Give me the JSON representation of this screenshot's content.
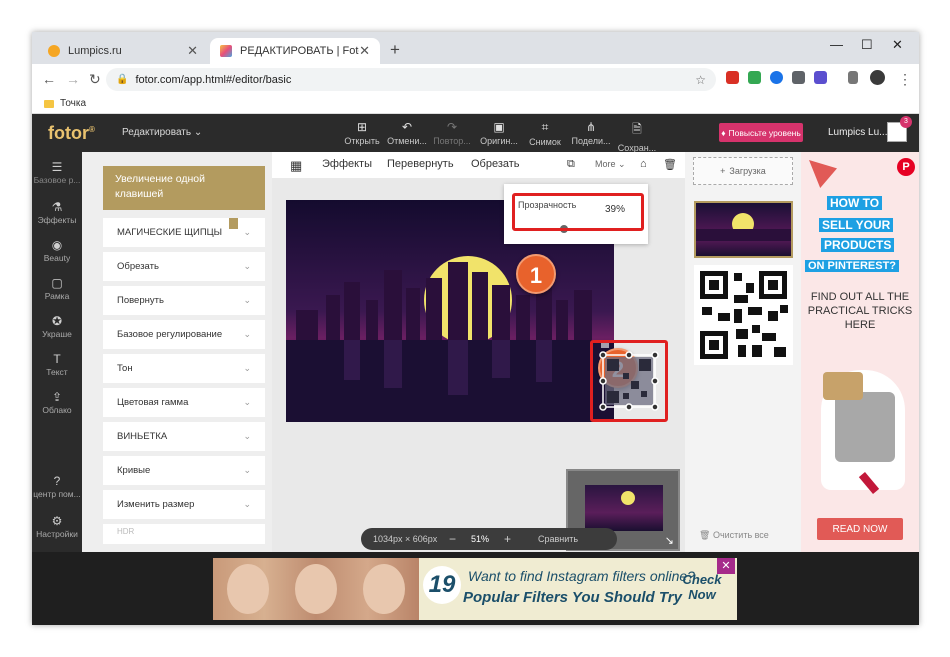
{
  "browser": {
    "tabs": [
      {
        "title": "Lumpics.ru",
        "favicon_color": "#f5a623",
        "active": false
      },
      {
        "title": "РЕДАКТИРОВАТЬ | Fotor",
        "favicon_color": "#e84f7a",
        "active": true
      }
    ],
    "url": "fotor.com/app.html#/editor/basic",
    "bookmark": "Точка",
    "window_controls": [
      "—",
      "☐",
      "✕"
    ]
  },
  "header": {
    "logo": "fotor",
    "logo_mark": "®",
    "edit_menu": "Редактировать",
    "tools": [
      {
        "label": "Открыть",
        "icon": "open-image-icon",
        "enabled": true
      },
      {
        "label": "Отмени...",
        "icon": "undo-icon",
        "enabled": true
      },
      {
        "label": "Повтор...",
        "icon": "redo-icon",
        "enabled": false
      },
      {
        "label": "Оригин...",
        "icon": "original-icon",
        "enabled": true
      },
      {
        "label": "Снимок",
        "icon": "snapshot-icon",
        "enabled": true
      },
      {
        "label": "Подели...",
        "icon": "share-icon",
        "enabled": true
      },
      {
        "label": "Сохран...",
        "icon": "save-icon",
        "enabled": true
      }
    ],
    "upgrade": "Повысьте уровень",
    "user": "Lumpics Lu...",
    "notifications": "3"
  },
  "rail": [
    {
      "label": "Базовое р...",
      "icon": "sliders-icon"
    },
    {
      "label": "Эффекты",
      "icon": "flask-icon"
    },
    {
      "label": "Beauty",
      "icon": "eye-icon"
    },
    {
      "label": "Рамка",
      "icon": "frame-icon"
    },
    {
      "label": "Украше",
      "icon": "star-icon"
    },
    {
      "label": "Текст",
      "icon": "text-icon"
    },
    {
      "label": "Облако",
      "icon": "cloud-upload-icon"
    },
    {
      "label": "центр пом...",
      "icon": "help-icon"
    },
    {
      "label": "Настройки",
      "icon": "settings-icon"
    }
  ],
  "panel": {
    "highlight": "Увеличение одной клавишей",
    "sections": [
      "МАГИЧЕСКИЕ ЩИПЦЫ",
      "Обрезать",
      "Повернуть",
      "Базовое регулирование",
      "Тон",
      "Цветовая гамма",
      "ВИНЬЕТКА",
      "Кривые",
      "Изменить размер",
      "HDR"
    ]
  },
  "canvas_toolbar": {
    "effects": "Эффекты",
    "flip": "Перевернуть",
    "crop": "Обрезать",
    "more": "More"
  },
  "opacity": {
    "label": "Прозрачность",
    "value": "39%",
    "fraction": 0.39
  },
  "callouts": [
    "1",
    "2"
  ],
  "zoom": {
    "size": "1034px × 606px",
    "percent": "51%",
    "minus": "−",
    "plus": "+",
    "compare": "Сравнить"
  },
  "right_panel": {
    "upload": "Загрузка",
    "clear": "Очистить все"
  },
  "ad_right": {
    "l1": "HOW TO",
    "l2": "SELL YOUR",
    "l3": "PRODUCTS",
    "l4": "ON PINTEREST?",
    "body": "FIND OUT ALL THE PRACTICAL TRICKS HERE",
    "button": "READ NOW",
    "pin": "P"
  },
  "ad_bottom": {
    "number": "19",
    "line1": "Want to find Instagram filters online?",
    "line2": "Popular Filters You Should Try",
    "cta": "Check Now",
    "close": "✕"
  },
  "colors": {
    "accent_gold": "#b39b5f",
    "highlight_red": "#e02020",
    "callout_orange": "#e8622c",
    "upgrade_pink": "#d6336c"
  }
}
